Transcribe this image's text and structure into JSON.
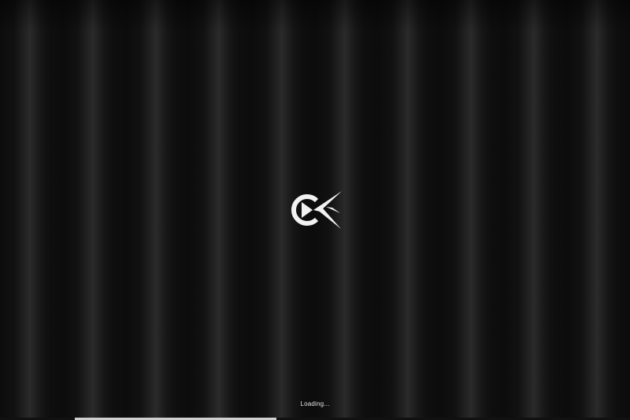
{
  "loading": {
    "text": "Loading...",
    "progress_start": 0.119,
    "progress_value": 0.32
  },
  "logo": {
    "icon": "play-x-logo-icon",
    "color": "#f2f2f2"
  },
  "theme": {
    "background": "#0d0d0d",
    "text_color": "#e6e6e6",
    "progress_color": "#cfcfcf"
  }
}
